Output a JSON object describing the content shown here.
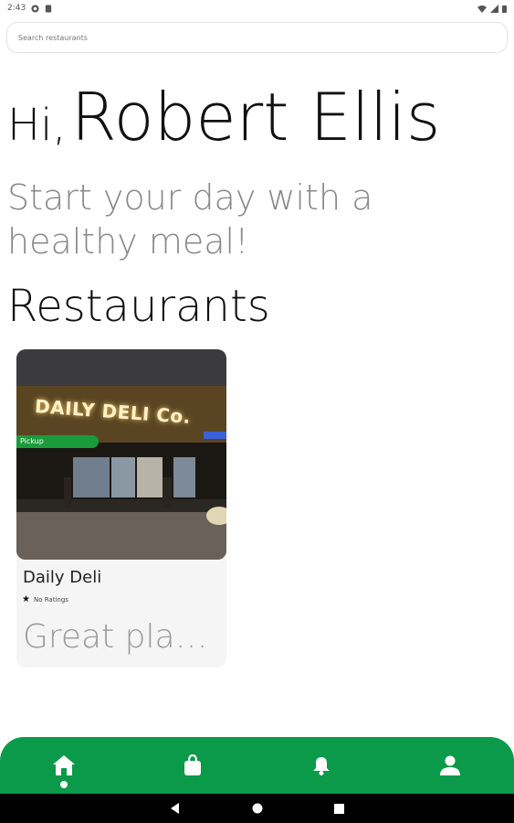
{
  "status_bar": {
    "time": "2:43"
  },
  "search": {
    "placeholder": "Search restaurants"
  },
  "greeting": {
    "hi": "Hi,",
    "name": "Robert Ellis"
  },
  "subtitle": "Start your day with a healthy meal!",
  "section_title": "Restaurants",
  "restaurants": [
    {
      "name": "Daily Deli",
      "badge": "Pickup",
      "rating_text": "No Ratings",
      "description": "Great plac...",
      "image_sign": "DAILY DELI Co."
    }
  ],
  "nav": {
    "items": [
      {
        "icon": "home-icon",
        "active": true
      },
      {
        "icon": "shopping-bag-icon",
        "active": false
      },
      {
        "icon": "bell-icon",
        "active": false
      },
      {
        "icon": "profile-icon",
        "active": false
      }
    ]
  },
  "colors": {
    "accent": "#0b9a49",
    "badge": "#1a9b3c"
  }
}
